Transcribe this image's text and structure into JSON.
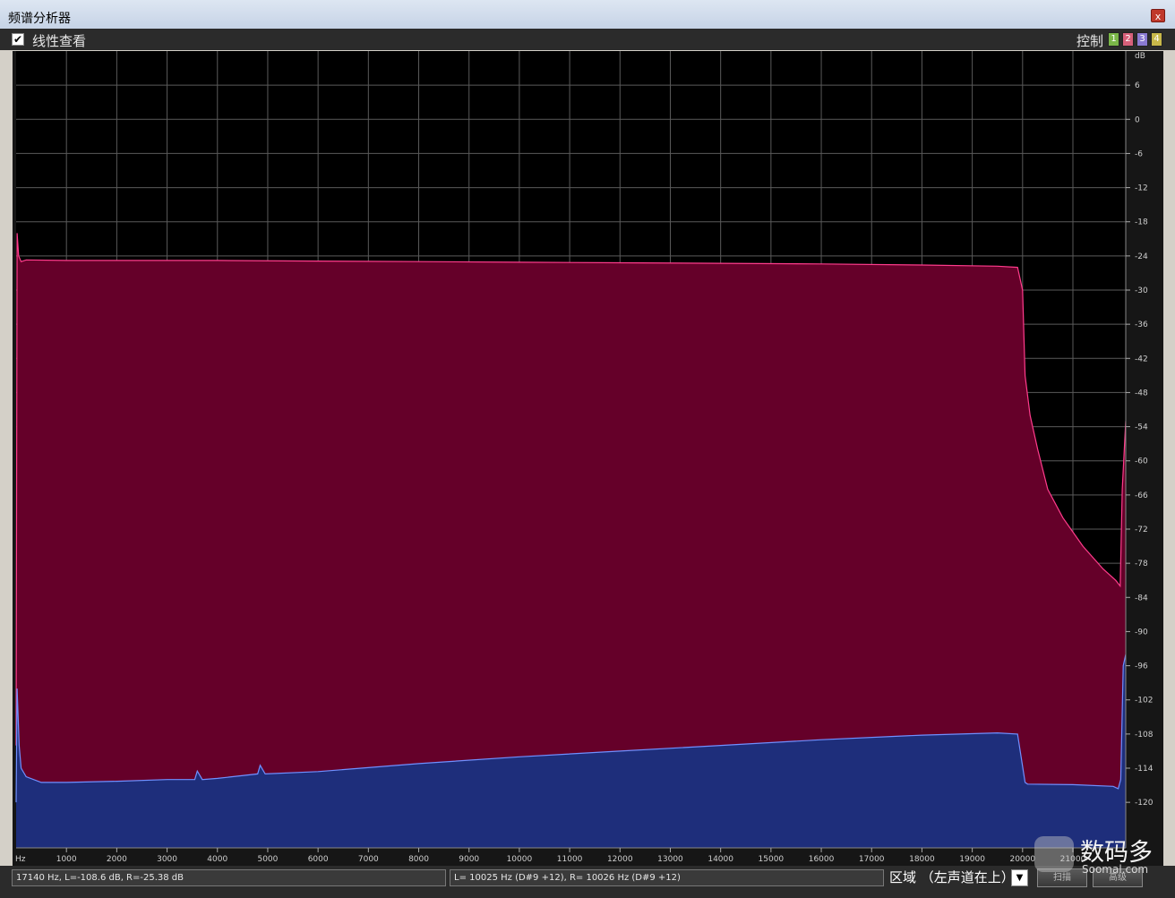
{
  "window": {
    "title": "频谱分析器",
    "close_glyph": "x"
  },
  "toolbar": {
    "linear_view_checked": true,
    "linear_view_label": "线性查看",
    "control_label": "控制",
    "channel_buttons": [
      {
        "label": "1",
        "color": "#7ab648"
      },
      {
        "label": "2",
        "color": "#d6607a"
      },
      {
        "label": "3",
        "color": "#8a7ad2"
      },
      {
        "label": "4",
        "color": "#c8b84a"
      }
    ]
  },
  "plot": {
    "background": "#000000",
    "grid_color": "#5a5a5a",
    "x_unit_label": "Hz",
    "y_unit_label": "dB",
    "x_ticks": [
      1000,
      2000,
      3000,
      4000,
      5000,
      6000,
      7000,
      8000,
      9000,
      10000,
      11000,
      12000,
      13000,
      14000,
      15000,
      16000,
      17000,
      18000,
      19000,
      20000,
      21000
    ],
    "y_ticks": [
      6,
      0,
      -6,
      -12,
      -18,
      -24,
      -30,
      -36,
      -42,
      -48,
      -54,
      -60,
      -66,
      -72,
      -78,
      -84,
      -90,
      -96,
      -102,
      -108,
      -114,
      -120
    ]
  },
  "chart_data": {
    "type": "area",
    "xlabel": "Hz",
    "ylabel": "dB",
    "xlim": [
      0,
      22050
    ],
    "ylim": [
      -128,
      12
    ],
    "grid": true,
    "series": [
      {
        "color": "#650029",
        "line_color": "#ff3c8c",
        "x": [
          0,
          20,
          50,
          100,
          200,
          1000,
          2000,
          4000,
          6000,
          8000,
          10000,
          12000,
          14000,
          16000,
          18000,
          19500,
          19900,
          20000,
          20050,
          20150,
          20300,
          20500,
          20800,
          21200,
          21600,
          21850,
          21940,
          21980,
          22050
        ],
        "y": [
          -110,
          -20,
          -24,
          -25,
          -24.7,
          -24.8,
          -24.8,
          -24.8,
          -24.9,
          -25,
          -25.1,
          -25.2,
          -25.3,
          -25.4,
          -25.6,
          -25.8,
          -26,
          -30,
          -45,
          -52,
          -58,
          -65,
          -70,
          -75,
          -79,
          -81,
          -82,
          -65,
          -53
        ]
      },
      {
        "color": "#1e2e7b",
        "line_color": "#7090ff",
        "x": [
          0,
          20,
          60,
          100,
          200,
          500,
          1000,
          2000,
          3000,
          3550,
          3600,
          3700,
          4000,
          4800,
          4850,
          4950,
          6000,
          8000,
          10000,
          12000,
          14000,
          16000,
          18000,
          19500,
          19900,
          20050,
          20100,
          21000,
          21800,
          21900,
          21950,
          22000,
          22050
        ],
        "y": [
          -120,
          -100,
          -110,
          -114,
          -115.5,
          -116.5,
          -116.5,
          -116.3,
          -116,
          -116,
          -114.5,
          -116,
          -115.8,
          -115,
          -113.5,
          -115,
          -114.6,
          -113.2,
          -112,
          -111,
          -110,
          -109,
          -108.2,
          -107.8,
          -108,
          -116.5,
          -116.8,
          -116.9,
          -117.2,
          -117.6,
          -116,
          -96,
          -94
        ]
      }
    ]
  },
  "status": {
    "cursor_readout": "17140 Hz, L=-108.6 dB, R=-25.38 dB",
    "peak_readout": "L=  10025 Hz (D#9 +12), R=  10026 Hz (D#9 +12)",
    "region_label": "区域 （左声道在上）",
    "dropdown_glyph": "▼",
    "button_1": "扫描",
    "button_2": "高级"
  },
  "watermark": {
    "brand": "数码多",
    "url": "Soomal.com"
  }
}
